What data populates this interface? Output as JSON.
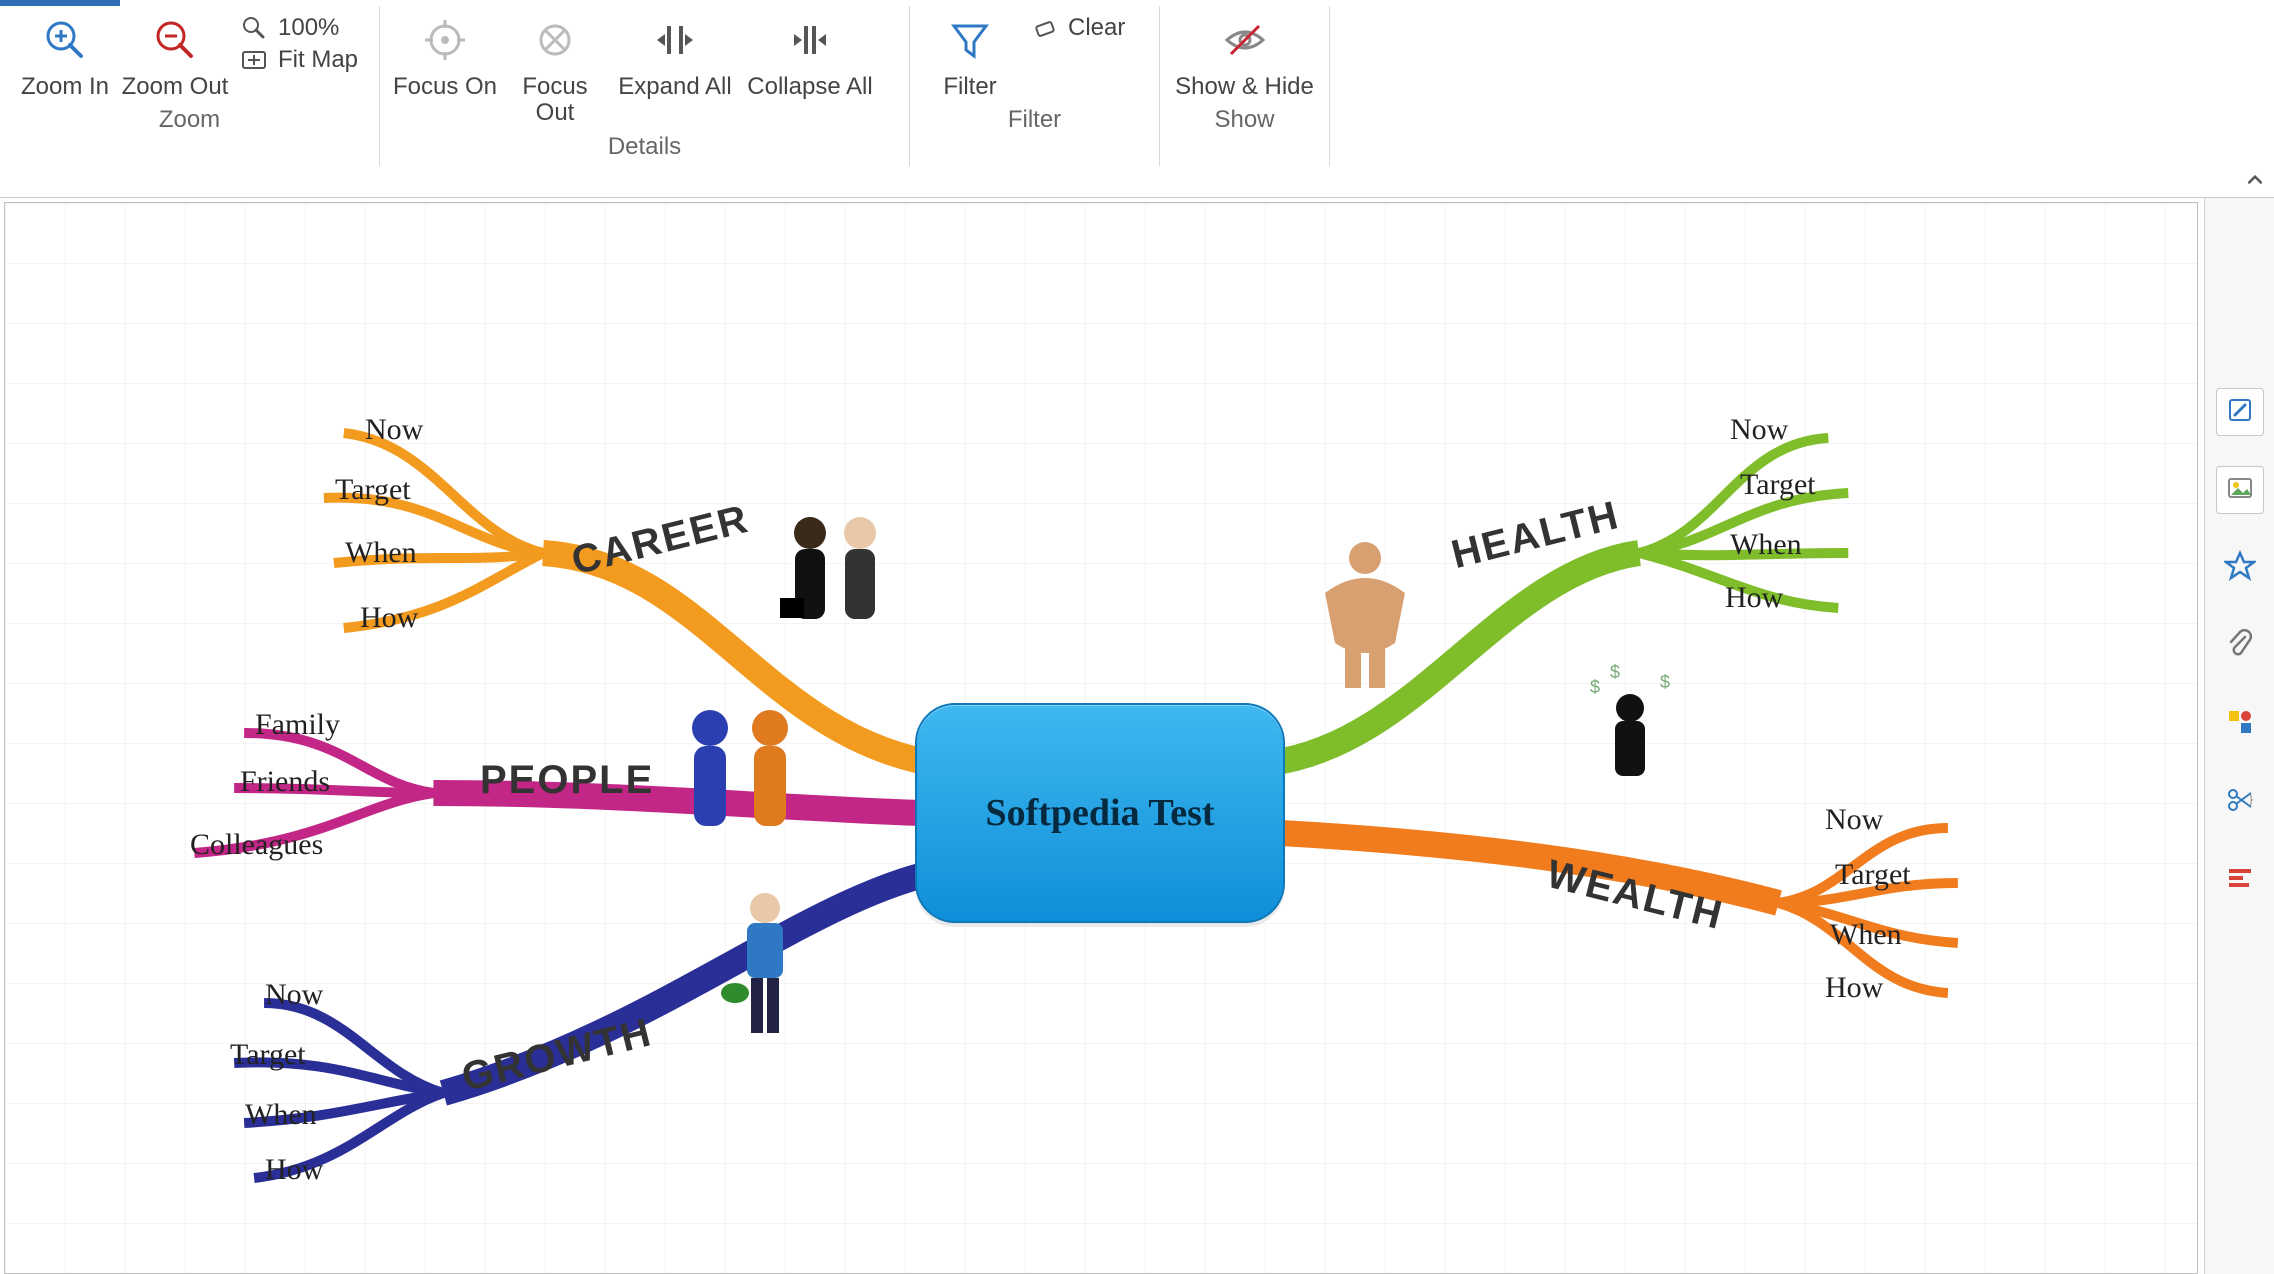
{
  "ribbon": {
    "groups": {
      "zoom": {
        "label": "Zoom",
        "zoom_in": "Zoom In",
        "zoom_out": "Zoom Out",
        "zoom_level": "100%",
        "fit_map": "Fit Map"
      },
      "details": {
        "label": "Details",
        "focus_on": "Focus On",
        "focus_out": "Focus Out",
        "expand_all": "Expand All",
        "collapse_all": "Collapse All"
      },
      "filter": {
        "label": "Filter",
        "filter": "Filter",
        "clear": "Clear"
      },
      "show": {
        "label": "Show",
        "show_hide": "Show & Hide"
      }
    }
  },
  "mindmap": {
    "central": "Softpedia Test",
    "branches": {
      "career": {
        "title": "CAREER",
        "color": "#F39B1E",
        "children": [
          "Now",
          "Target",
          "When",
          "How"
        ]
      },
      "people": {
        "title": "PEOPLE",
        "color": "#C22686",
        "children": [
          "Family",
          "Friends",
          "Colleagues"
        ]
      },
      "growth": {
        "title": "GROWTH",
        "color": "#2A2F98",
        "children": [
          "Now",
          "Target",
          "When",
          "How"
        ]
      },
      "health": {
        "title": "HEALTH",
        "color": "#7FBE2A",
        "children": [
          "Now",
          "Target",
          "When",
          "How"
        ]
      },
      "wealth": {
        "title": "WEALTH",
        "color": "#F07C1D",
        "children": [
          "Now",
          "Target",
          "When",
          "How"
        ]
      }
    }
  },
  "sidepanel": {
    "items": [
      "edit-icon",
      "image-icon",
      "star-icon",
      "attachment-icon",
      "shapes-icon",
      "cut-icon",
      "align-icon"
    ]
  }
}
